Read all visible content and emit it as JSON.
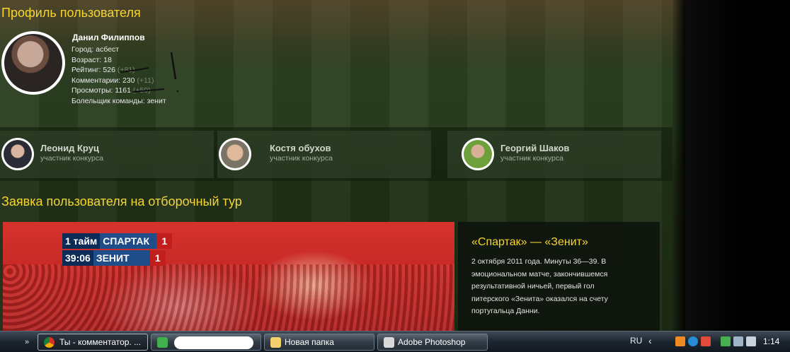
{
  "profile": {
    "title": "Профиль пользователя",
    "name": "Данил Филиппов",
    "stats": {
      "city": "Город: асбест",
      "age": "Возраст: 18",
      "rating_label": "Рейтинг: 526",
      "rating_delta": "(+81)",
      "comments_label": "Комментарии: 230",
      "comments_delta": "(+11)",
      "views_label": "Просмотры: 1161",
      "views_delta": "(+50)",
      "team": "Болельщик команды: зенит"
    }
  },
  "participants": [
    {
      "name": "Леонид Круц",
      "role": "участник конкурса"
    },
    {
      "name": "Костя обухов",
      "role": "участник конкурса"
    },
    {
      "name": "Георгий Шаков",
      "role": "участник конкурса"
    }
  ],
  "entry": {
    "title": "Заявка пользователя на отборочный тур",
    "scoreboard": {
      "period": "1 тайм",
      "time": "39:06",
      "team1": "СПАРТАК М",
      "team1_score": "1",
      "team2": "ЗЕНИТ",
      "team2_score": "1"
    },
    "match_title": "«Спартак» — «Зенит»",
    "description": "2 октября 2011 года. Минуты 36—39. В эмоциональном матче, закончившемся результативной ничьей, первый гол питерского «Зенита» оказался на счету португальца Данни."
  },
  "taskbar": {
    "buttons": [
      {
        "label": "Ты - комментатор. ...",
        "icon": "chrome-icon"
      },
      {
        "label": "",
        "icon": "notepad-icon"
      },
      {
        "label": "Новая папка",
        "icon": "folder-icon"
      },
      {
        "label": "Adobe Photoshop",
        "icon": "photoshop-icon"
      }
    ],
    "language": "RU",
    "clock": "1:14"
  },
  "colors": {
    "accent_yellow": "#f5d532",
    "card_bg": "#2d3e26",
    "taskbar": "#1c2530"
  }
}
